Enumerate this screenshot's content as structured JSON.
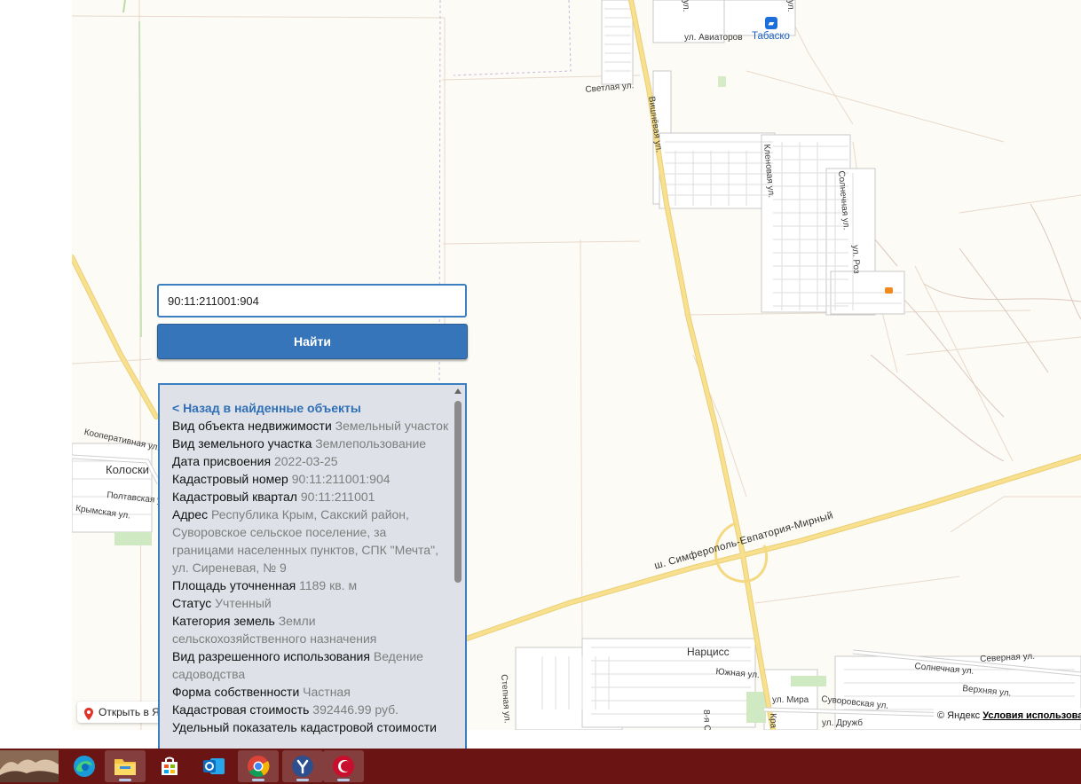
{
  "map": {
    "streets": {
      "aviatorov": "ул. Авиаторов",
      "svetlaya": "Светлая ул.",
      "vishnevaya": "Вишнёвая ул.",
      "klenovaya": "Кленовая ул.",
      "solnechnaya_top": "Солнечная ул.",
      "roz": "ул. Роз",
      "kooperativnaya": "Кооперативная ул.",
      "poltavskaya": "Полтавская ул.",
      "krymskaya": "Крымская ул.",
      "highway": "ш. Симферополь-Евпатория-Мирный",
      "stepnaya": "Степная ул.",
      "yuzhnaya": "Южная ул.",
      "mira": "ул. Мира",
      "suvorovskaya": "Суворовская ул.",
      "solnechnaya_bottom": "Солнечная ул.",
      "severnaya": "Северная ул.",
      "verkhnyaya": "Верхняя ул.",
      "druzhby": "ул. Дружб",
      "vosmaya": "8-я С",
      "kra": "Кра",
      "fragment_top": "ул.",
      "fragment_top2": "ул."
    },
    "places": {
      "koloski": "Колоски",
      "nartsiss": "Нарцисс"
    },
    "poi": {
      "label": "Табаско",
      "icon": "shop-icon"
    },
    "open_in_label": "Открыть в Яндекс Картах",
    "copyright_text": "© Яндекс",
    "terms_link": "Условия использования"
  },
  "search": {
    "input_value": "90:11:211001:904",
    "button_label": "Найти"
  },
  "details": {
    "back_label": "< Назад в найденные объекты",
    "rows": [
      {
        "label": "Вид объекта недвижимости",
        "value": "Земельный участок"
      },
      {
        "label": "Вид земельного участка",
        "value": "Землепользование"
      },
      {
        "label": "Дата присвоения",
        "value": "2022-03-25"
      },
      {
        "label": "Кадастровый номер",
        "value": "90:11:211001:904"
      },
      {
        "label": "Кадастровый квартал",
        "value": "90:11:211001"
      },
      {
        "label": "Адрес",
        "value": "Республика Крым, Сакский район, Суворовское сельское поселение, за границами населенных пунктов, СПК \"Мечта\", ул. Сиреневая, № 9"
      },
      {
        "label": "Площадь уточненная",
        "value": "1189 кв. м"
      },
      {
        "label": "Статус",
        "value": "Учтенный"
      },
      {
        "label": "Категория земель",
        "value": "Земли сельскохозяйственного назначения"
      },
      {
        "label": "Вид разрешенного использования",
        "value": "Ведение садоводства"
      },
      {
        "label": "Форма собственности",
        "value": "Частная"
      },
      {
        "label": "Кадастровая стоимость",
        "value": "392446.99 руб."
      },
      {
        "label": "Удельный показатель кадастровой стоимости",
        "value": ""
      }
    ]
  },
  "taskbar": {
    "apps": [
      {
        "icon": "wallpaper-thumbnail-icon"
      },
      {
        "icon": "edge-icon"
      },
      {
        "icon": "file-explorer-icon",
        "active": true
      },
      {
        "icon": "microsoft-store-icon"
      },
      {
        "icon": "outlook-icon"
      },
      {
        "icon": "chrome-icon",
        "active": true
      },
      {
        "icon": "yandex-browser-icon",
        "active": true
      },
      {
        "icon": "red-app-icon",
        "active": true
      }
    ]
  },
  "colors": {
    "map_background": "#fdfbf5",
    "major_road": "#f8e08e",
    "accent_blue": "#3675b9",
    "panel_background": "#dee2e8",
    "taskbar": "#6b1414",
    "parcel": "#f08a1c"
  }
}
